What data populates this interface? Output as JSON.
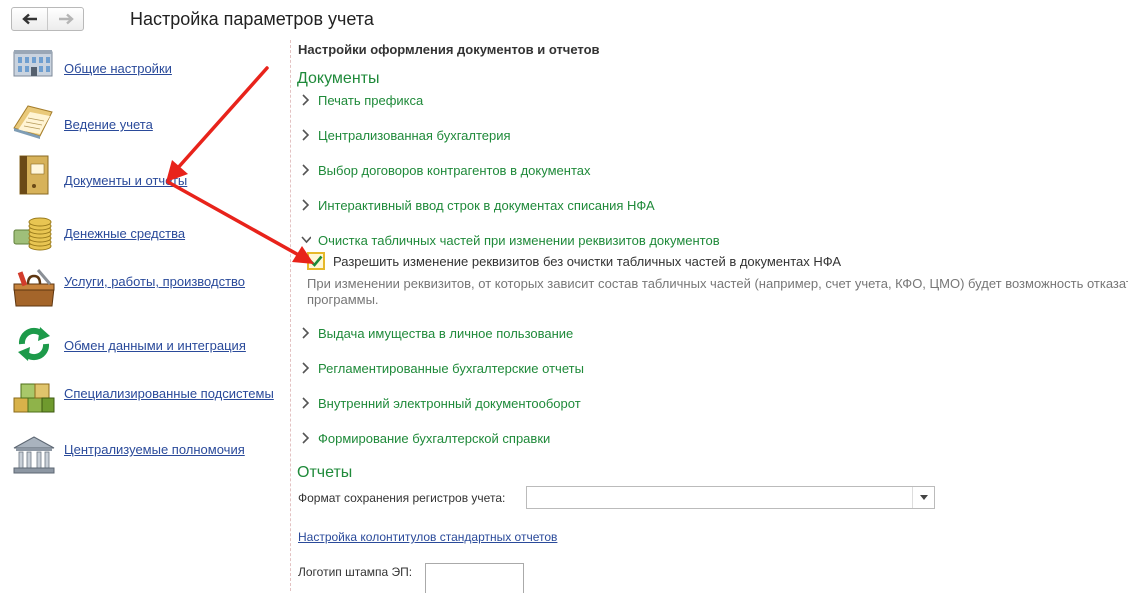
{
  "header": {
    "back_icon": "arrow-left-icon",
    "forward_icon": "arrow-right-icon",
    "title": "Настройка параметров учета"
  },
  "sidebar": {
    "items": [
      {
        "label": "Общие настройки",
        "icon": "building-icon"
      },
      {
        "label": "Ведение учета",
        "icon": "ledger-icon"
      },
      {
        "label": "Документы и отчеты",
        "icon": "binder-icon"
      },
      {
        "label": "Денежные средства",
        "icon": "coins-icon"
      },
      {
        "label": "Услуги, работы, производство",
        "icon": "toolbox-icon"
      },
      {
        "label": "Обмен данными и интеграция",
        "icon": "sync-icon"
      },
      {
        "label": "Специализированные подсистемы",
        "icon": "cubes-icon"
      },
      {
        "label": "Централизуемые полномочия",
        "icon": "bank-icon"
      }
    ]
  },
  "main": {
    "section_title": "Настройки оформления документов и отчетов",
    "documents_heading": "Документы",
    "document_groups": [
      {
        "label": "Печать префикса",
        "expanded": false
      },
      {
        "label": "Централизованная бухгалтерия",
        "expanded": false
      },
      {
        "label": "Выбор договоров контрагентов в документах",
        "expanded": false
      },
      {
        "label": "Интерактивный ввод строк в документах списания НФА",
        "expanded": false
      },
      {
        "label": "Очистка табличных частей при изменении реквизитов документов",
        "expanded": true
      }
    ],
    "checkbox": {
      "checked": true,
      "label": "Разрешить изменение реквизитов без очистки табличных частей в документах НФА"
    },
    "hint": "При изменении реквизитов, от которых зависит состав табличных частей (например, счет учета, КФО, ЦМО) будет возможность отказат",
    "hint_line2": "программы.",
    "more_groups": [
      {
        "label": "Выдача имущества в личное пользование"
      },
      {
        "label": "Регламентированные бухгалтерские отчеты"
      },
      {
        "label": "Внутренний электронный документооборот"
      },
      {
        "label": "Формирование бухгалтерской справки"
      }
    ],
    "reports_heading": "Отчеты",
    "register_format_label": "Формат сохранения регистров учета:",
    "register_format_value": "",
    "headers_link": "Настройка колонтитулов стандартных отчетов",
    "stamp_logo_label": "Логотип штампа ЭП:"
  },
  "colors": {
    "accent_green": "#1f8a3a",
    "link_blue": "#2a4a9a",
    "annotation_arrow": "#e8231b"
  }
}
